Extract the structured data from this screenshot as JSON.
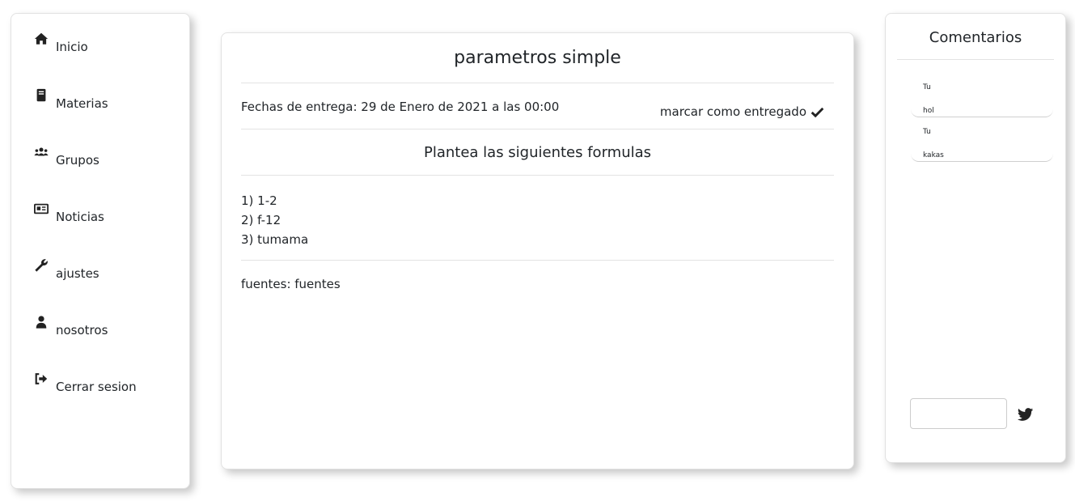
{
  "sidebar": {
    "items": [
      {
        "label": "Inicio",
        "icon": "home-icon"
      },
      {
        "label": "Materias",
        "icon": "book-icon"
      },
      {
        "label": "Grupos",
        "icon": "users-icon"
      },
      {
        "label": "Noticias",
        "icon": "newspaper-icon"
      },
      {
        "label": "ajustes",
        "icon": "wrench-icon"
      },
      {
        "label": "nosotros",
        "icon": "user-icon"
      },
      {
        "label": "Cerrar sesion",
        "icon": "sign-out-icon"
      }
    ]
  },
  "main": {
    "title": "parametros simple",
    "due": "Fechas de entrega: 29 de Enero de 2021 a las 00:00",
    "mark_done": "marcar como entregado",
    "mark_done_icon": "check-icon",
    "subtitle": "Plantea las siguientes formulas",
    "formulas": [
      "1) 1-2",
      "2) f-12",
      "3) tumama"
    ],
    "sources": "fuentes: fuentes"
  },
  "comments": {
    "title": "Comentarios",
    "items": [
      {
        "author": "Tu",
        "text": "hol"
      },
      {
        "author": "Tu",
        "text": "kakas"
      }
    ],
    "input_value": "",
    "send_icon": "twitter-bird-icon"
  }
}
